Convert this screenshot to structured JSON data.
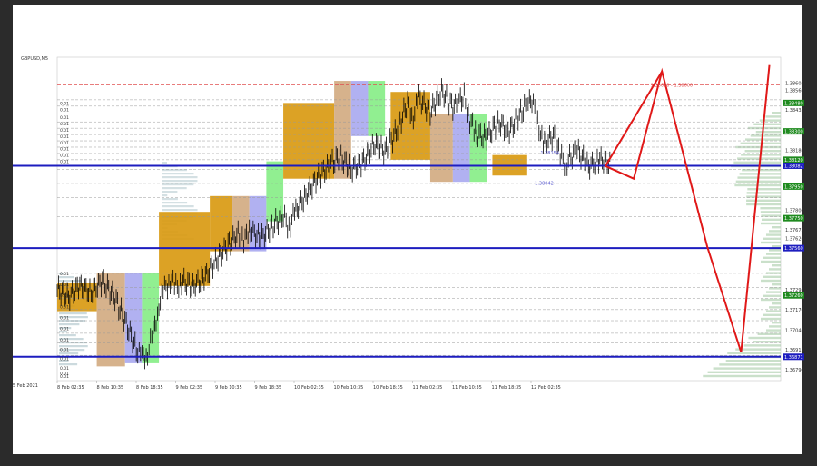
{
  "window": {
    "symbol_label": "GBPUSD,M5",
    "left_edge_date": "5 Feb 2021"
  },
  "colors": {
    "background": "#ffffff",
    "outer_frame": "#2b2b2b",
    "candle": "#000000",
    "sr_line": "#1d1dbf",
    "forecast": "#e01818",
    "gold_box": "#d99a12",
    "tan_box": "#d2ab82",
    "lavender_box": "#aaaaf0",
    "green_box": "#88ee88",
    "dashed_level": "#999999",
    "red_dashed": "#e05050",
    "green_tag": "#1e8a1e",
    "blue_tag": "#1d1dbf",
    "volume_profile": "#b7cbd0",
    "volume_profile_right": "#a7cba7"
  },
  "chart_data": {
    "type": "candlestick",
    "title": "",
    "symbol": "GBPUSD,M5",
    "xlabel": "",
    "ylabel": "",
    "ylim": [
      1.3672,
      1.3877
    ],
    "y_ticks": [
      "1.38605",
      "1.38560",
      "1.38435",
      "1.38180",
      "1.37800",
      "1.37675",
      "1.37620",
      "1.37295",
      "1.37170",
      "1.37040",
      "1.36915",
      "1.36790"
    ],
    "x_ticks": [
      "5 Feb 2021",
      "8 Feb 02:35",
      "8 Feb 10:35",
      "8 Feb 18:35",
      "9 Feb 02:35",
      "9 Feb 10:35",
      "9 Feb 18:35",
      "10 Feb 02:35",
      "10 Feb 10:35",
      "10 Feb 18:35",
      "11 Feb 02:35",
      "11 Feb 10:35",
      "11 Feb 18:35",
      "12 Feb 02:35"
    ],
    "green_price_tags": [
      "1.38480",
      "1.38300",
      "1.38120",
      "1.37950",
      "1.37750",
      "1.37260"
    ],
    "blue_price_tags": [
      "1.38082",
      "1.37560",
      "1.36871"
    ],
    "support_resistance_levels": [
      1.38082,
      1.3756,
      1.36871
    ],
    "annotations": [
      "1.38042",
      "1.38154",
      "1.38680 - 1.38600"
    ],
    "left_level_labels": [
      "0.01",
      "0.01",
      "0.01",
      "0.01",
      "0.01",
      "0.01",
      "0.01",
      "0.01",
      "0.01",
      "0.01",
      "0.01",
      "0.01",
      "0.01",
      "0.01",
      "0.01",
      "0.01",
      "0.01",
      "0.01",
      "0.01",
      "0.01",
      "0.01",
      "0.01"
    ],
    "price_path": [
      [
        0,
        1.373
      ],
      [
        2,
        1.3725
      ],
      [
        4,
        1.3732
      ],
      [
        6,
        1.3728
      ],
      [
        8,
        1.3735
      ],
      [
        10,
        1.3726
      ],
      [
        12,
        1.371
      ],
      [
        14,
        1.3692
      ],
      [
        15,
        1.3686
      ],
      [
        16,
        1.369
      ],
      [
        17,
        1.3702
      ],
      [
        18,
        1.372
      ],
      [
        19,
        1.373
      ],
      [
        20,
        1.3736
      ],
      [
        21,
        1.3731
      ],
      [
        22,
        1.3735
      ],
      [
        24,
        1.3732
      ],
      [
        26,
        1.3737
      ],
      [
        28,
        1.3748
      ],
      [
        30,
        1.3757
      ],
      [
        32,
        1.3765
      ],
      [
        33,
        1.376
      ],
      [
        34,
        1.3768
      ],
      [
        36,
        1.3762
      ],
      [
        38,
        1.377
      ],
      [
        40,
        1.3776
      ],
      [
        41,
        1.377
      ],
      [
        42,
        1.3778
      ],
      [
        44,
        1.379
      ],
      [
        46,
        1.38
      ],
      [
        48,
        1.3808
      ],
      [
        50,
        1.3814
      ],
      [
        52,
        1.3806
      ],
      [
        54,
        1.381
      ],
      [
        56,
        1.3822
      ],
      [
        58,
        1.3817
      ],
      [
        60,
        1.383
      ],
      [
        62,
        1.3848
      ],
      [
        63,
        1.384
      ],
      [
        64,
        1.3851
      ],
      [
        66,
        1.3842
      ],
      [
        68,
        1.3856
      ],
      [
        70,
        1.3845
      ],
      [
        72,
        1.3852
      ],
      [
        73,
        1.3838
      ],
      [
        74,
        1.3828
      ],
      [
        76,
        1.3826
      ],
      [
        78,
        1.3836
      ],
      [
        80,
        1.383
      ],
      [
        82,
        1.3842
      ],
      [
        84,
        1.385
      ],
      [
        85,
        1.3836
      ],
      [
        86,
        1.3822
      ],
      [
        88,
        1.3828
      ],
      [
        89,
        1.3814
      ],
      [
        90,
        1.381
      ],
      [
        92,
        1.3818
      ],
      [
        94,
        1.3808
      ],
      [
        96,
        1.3812
      ],
      [
        98,
        1.381
      ]
    ],
    "forecast_path": [
      [
        97,
        1.3808
      ],
      [
        102,
        1.38
      ],
      [
        107,
        1.3868
      ],
      [
        115,
        1.3757
      ],
      [
        121,
        1.369
      ],
      [
        126,
        1.3872
      ]
    ],
    "forecast_path_2": [
      [
        97,
        1.3808
      ],
      [
        107,
        1.3868
      ]
    ],
    "zones": [
      {
        "color": "gold",
        "x0": 0,
        "x1": 7,
        "y0": 1.3716,
        "y1": 1.3734
      },
      {
        "color": "tan",
        "x0": 7,
        "x1": 12,
        "y0": 1.3681,
        "y1": 1.374
      },
      {
        "color": "lavender",
        "x0": 12,
        "x1": 15,
        "y0": 1.3683,
        "y1": 1.374
      },
      {
        "color": "green",
        "x0": 15,
        "x1": 18,
        "y0": 1.3683,
        "y1": 1.374
      },
      {
        "color": "gold",
        "x0": 18,
        "x1": 27,
        "y0": 1.3732,
        "y1": 1.3779
      },
      {
        "color": "gold",
        "x0": 27,
        "x1": 31,
        "y0": 1.3754,
        "y1": 1.3789
      },
      {
        "color": "tan",
        "x0": 31,
        "x1": 34,
        "y0": 1.3754,
        "y1": 1.3789
      },
      {
        "color": "lavender",
        "x0": 34,
        "x1": 37,
        "y0": 1.3754,
        "y1": 1.3789
      },
      {
        "color": "green",
        "x0": 37,
        "x1": 40,
        "y0": 1.3773,
        "y1": 1.3811
      },
      {
        "color": "gold",
        "x0": 40,
        "x1": 49,
        "y0": 1.38,
        "y1": 1.3848
      },
      {
        "color": "tan",
        "x0": 49,
        "x1": 52,
        "y0": 1.38,
        "y1": 1.3862
      },
      {
        "color": "lavender",
        "x0": 52,
        "x1": 55,
        "y0": 1.3827,
        "y1": 1.3862
      },
      {
        "color": "green",
        "x0": 55,
        "x1": 58,
        "y0": 1.3827,
        "y1": 1.3862
      },
      {
        "color": "gold",
        "x0": 59,
        "x1": 66,
        "y0": 1.3812,
        "y1": 1.3855
      },
      {
        "color": "tan",
        "x0": 66,
        "x1": 70,
        "y0": 1.3798,
        "y1": 1.3841
      },
      {
        "color": "lavender",
        "x0": 70,
        "x1": 73,
        "y0": 1.3798,
        "y1": 1.3841
      },
      {
        "color": "green",
        "x0": 73,
        "x1": 76,
        "y0": 1.3798,
        "y1": 1.3841
      },
      {
        "color": "gold",
        "x0": 77,
        "x1": 83,
        "y0": 1.3802,
        "y1": 1.3815
      }
    ]
  }
}
